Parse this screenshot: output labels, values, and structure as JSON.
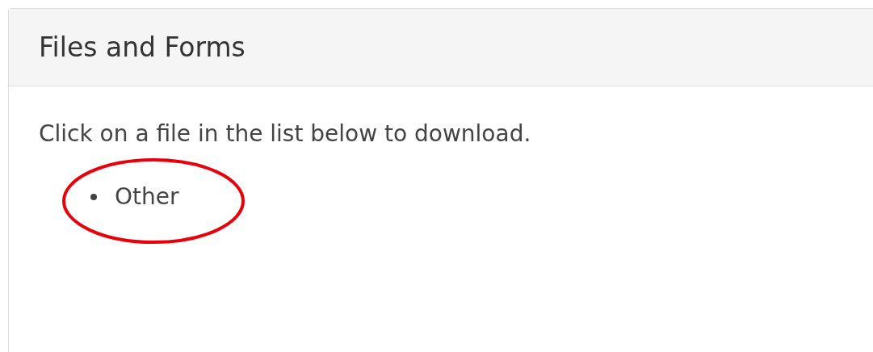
{
  "panel": {
    "title": "Files and Forms",
    "instructions": "Click on a file in the list below to download.",
    "files": [
      {
        "label": "Other",
        "circled": true
      }
    ]
  }
}
